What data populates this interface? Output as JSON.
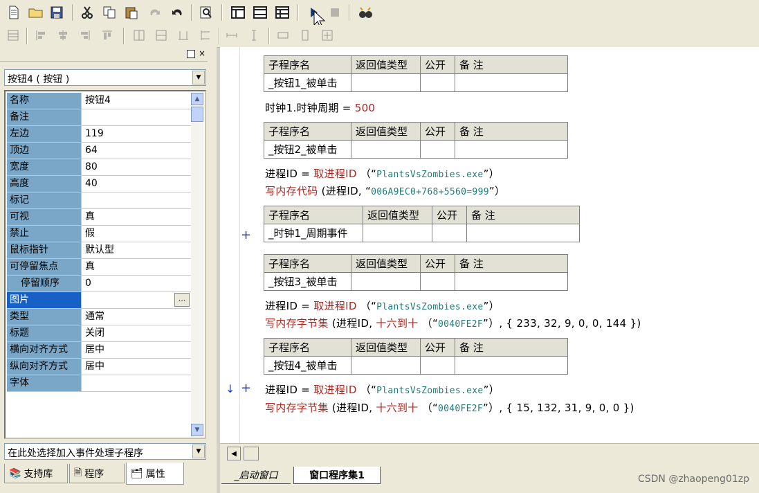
{
  "colors": {
    "selected_row": "#1660c6",
    "prop_name_bg": "#7aa7c7",
    "table_header": "#e1e1d5",
    "red_code": "#b3261e",
    "string": "#1f7a7a"
  },
  "toolbar1": {
    "icons": [
      "new-file-icon",
      "open-folder-icon",
      "save-icon",
      "cut-icon",
      "copy-icon",
      "paste-icon",
      "redo-icon",
      "undo-icon",
      "find-icon",
      "layout1-icon",
      "layout2-icon",
      "layout3-icon",
      "run-icon",
      "stop-icon",
      "debug-icon"
    ]
  },
  "toolbar2": {
    "icons": [
      "align-grid-icon",
      "align-left-icon",
      "align-center-icon",
      "align-right-icon",
      "align-top-icon",
      "align-middle-icon",
      "align-bottom-icon",
      "same-width-icon",
      "same-height-icon",
      "same-size-icon",
      "h-space-icon",
      "v-space-icon",
      "center-h-icon",
      "center-v-icon",
      "center-both-icon"
    ]
  },
  "left_panel": {
    "object_select": "按钮4 ( 按钮 )",
    "properties": [
      {
        "name": "名称",
        "value": "按钮4"
      },
      {
        "name": "备注",
        "value": ""
      },
      {
        "name": "左边",
        "value": "119"
      },
      {
        "name": "顶边",
        "value": "64"
      },
      {
        "name": "宽度",
        "value": "80"
      },
      {
        "name": "高度",
        "value": "40"
      },
      {
        "name": "标记",
        "value": ""
      },
      {
        "name": "可视",
        "value": "真"
      },
      {
        "name": "禁止",
        "value": "假"
      },
      {
        "name": "鼠标指针",
        "value": "默认型"
      },
      {
        "name": "可停留焦点",
        "value": "真"
      },
      {
        "name": "停留顺序",
        "value": "0"
      },
      {
        "name": "图片",
        "value": ""
      },
      {
        "name": "类型",
        "value": "通常"
      },
      {
        "name": "标题",
        "value": "关闭"
      },
      {
        "name": "横向对齐方式",
        "value": "居中"
      },
      {
        "name": "纵向对齐方式",
        "value": "居中"
      },
      {
        "name": "字体",
        "value": ""
      }
    ],
    "event_select": "在此处选择加入事件处理子程序",
    "tabs": [
      "支持库",
      "程序",
      "属性"
    ],
    "ellipsis": "..."
  },
  "editor": {
    "header": {
      "name": "子程序名",
      "ret": "返回值类型",
      "public": "公开",
      "note": "备 注"
    },
    "subs": [
      "_按钮1_被单击",
      "_按钮2_被单击",
      "_时钟1_周期事件",
      "_按钮3_被单击",
      "_按钮4_被单击"
    ],
    "lines": {
      "l1": {
        "a": "时钟1.时钟周期",
        "b": "=",
        "c": "500"
      },
      "l2": {
        "a": "进程ID",
        "b": "=",
        "c": "取进程ID",
        "d": "（“",
        "e": "PlantsVsZombies.exe",
        "f": "”）"
      },
      "l3": {
        "a": "写内存代码",
        "b": "(进程ID,",
        "c": "“",
        "d": "006A9EC0+768+5560=999",
        "e": "”）"
      },
      "l4": {
        "a": "进程ID",
        "b": "=",
        "c": "取进程ID",
        "d": "（“",
        "e": "PlantsVsZombies.exe",
        "f": "”）"
      },
      "l5": {
        "a": "写内存字节集",
        "b": "(进程ID,",
        "c": "十六到十",
        "d": "（“",
        "e": "0040FE2F",
        "f": "”）, { 233, 32, 9, 0, 0, 144 })"
      },
      "l6": {
        "a": "进程ID",
        "b": "=",
        "c": "取进程ID",
        "d": "（“",
        "e": "PlantsVsZombies.exe",
        "f": "”）"
      },
      "l7": {
        "a": "写内存字节集",
        "b": "(进程ID,",
        "c": "十六到十",
        "d": "（“",
        "e": "0040FE2F",
        "f": "”）, { 15, 132, 31, 9, 0, 0 })"
      }
    },
    "plus": "+",
    "marker": "↓"
  },
  "bottom_tabs": [
    "_启动窗口",
    "窗口程序集1"
  ],
  "watermark": "CSDN @zhaopeng01zp"
}
